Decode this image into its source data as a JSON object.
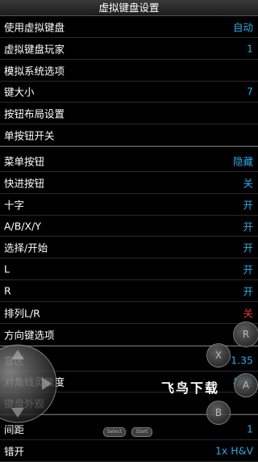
{
  "title": "虚拟键盘设置",
  "rows": [
    {
      "label": "使用虚拟键盘",
      "value": "自动"
    },
    {
      "label": "虚拟键盘玩家",
      "value": "1"
    },
    {
      "label": "模拟系统选项",
      "value": ""
    },
    {
      "label": "键大小",
      "value": "7"
    },
    {
      "label": "按钮布局设置",
      "value": ""
    },
    {
      "label": "单按钮开关",
      "value": ""
    },
    {
      "label": "菜单按钮",
      "value": "隐藏"
    },
    {
      "label": "快进按钮",
      "value": "关"
    },
    {
      "label": "十字",
      "value": "开"
    },
    {
      "label": "A/B/X/Y",
      "value": "开"
    },
    {
      "label": "选择/开始",
      "value": "开"
    },
    {
      "label": "L",
      "value": "开"
    },
    {
      "label": "R",
      "value": "开"
    },
    {
      "label": "排列L/R",
      "value": "关"
    },
    {
      "label": "方向键选项",
      "value": ""
    },
    {
      "label": "盲区",
      "value": "1.35"
    },
    {
      "label": "对角线灵敏度",
      "value": "标准"
    },
    {
      "label": "键盘外观",
      "value": ""
    },
    {
      "label": "间距",
      "value": "1"
    },
    {
      "label": "错开",
      "value": "1x H&V"
    }
  ],
  "overlay": {
    "r_button": "R",
    "x_button": "X",
    "a_button": "A",
    "b_button": "B",
    "select_button": "Select",
    "start_button": "Start",
    "watermark": "飞鸟下载"
  },
  "colors": {
    "value_blue": "#2fa9e6",
    "value_red": "#e23a2a"
  }
}
